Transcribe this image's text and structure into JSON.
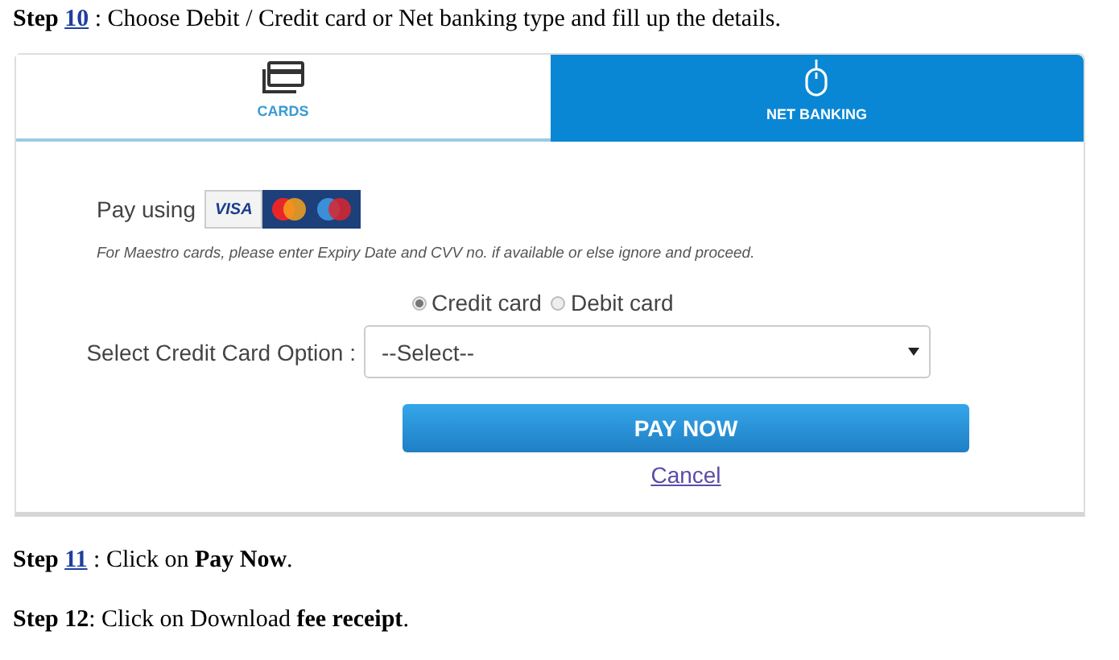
{
  "steps": [
    {
      "lead": "Step",
      "number": "10",
      "underlined": true,
      "text": " : Choose Debit / Credit card or Net banking type and fill up the details."
    }
  ],
  "payment_panel": {
    "tabs": [
      {
        "label": "CARDS",
        "kind": "card",
        "selected": true
      },
      {
        "label": "NET BANKING",
        "kind": "mouse",
        "selected": false
      }
    ],
    "pay_using": {
      "label": "Pay using",
      "brands": [
        {
          "kind": "visa",
          "text": "VISA"
        },
        {
          "kind": "mastercard"
        },
        {
          "kind": "maestro"
        }
      ]
    },
    "note": "For Maestro cards, please enter Expiry Date and CVV no. if available or else ignore and proceed.",
    "card_types": [
      {
        "label": "Credit card",
        "selected": true
      },
      {
        "label": "Debit card",
        "selected": false
      }
    ],
    "select": {
      "label": "Select Credit Card Option :",
      "value": "--Select--"
    },
    "pay_button": "PAY NOW",
    "cancel_link": "Cancel"
  },
  "steps_after": [
    {
      "lead": "Step",
      "number": "11",
      "underlined": true,
      "text": " : Click on **Pay Now**."
    },
    {
      "lead": "Step",
      "number": "12",
      "underlined": false,
      "text": ": Click on Download **fee receipt**."
    }
  ]
}
